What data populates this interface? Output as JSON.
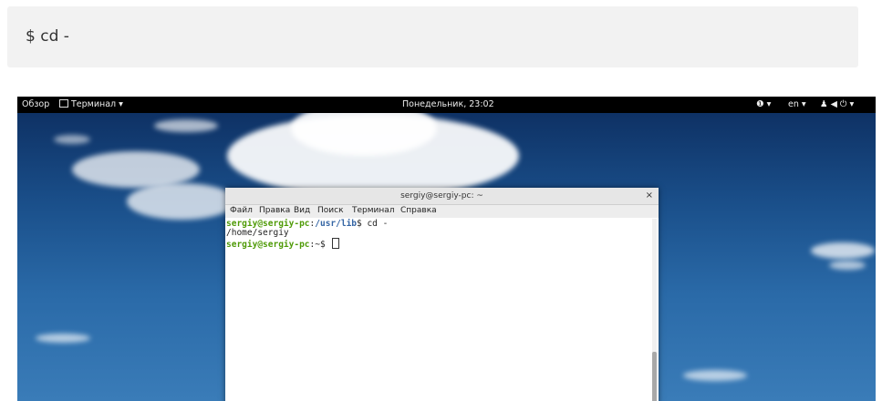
{
  "snippet": {
    "command": "$  cd -"
  },
  "topbar": {
    "overview": "Обзор",
    "app_menu": "Терминал ▾",
    "clock": "Понедельник, 23:02",
    "accessibility": "▾",
    "language": "en ▾",
    "status_icons": "⏻ ▾"
  },
  "terminal": {
    "title": "sergiy@sergiy-pc: ~",
    "close": "×",
    "menu": [
      "Файл",
      "Правка",
      "Вид",
      "Поиск",
      "Терминал",
      "Справка"
    ],
    "lines": {
      "l1_user": "sergiy@sergiy-pc",
      "l1_colon": ":",
      "l1_path": "/usr/lib",
      "l1_cmd": "$ cd -",
      "l2": "/home/sergiy",
      "l3_user": "sergiy@sergiy-pc",
      "l3_rest": ":~$ "
    }
  },
  "colors": {
    "prompt_user": "#4e9a06",
    "prompt_path": "#3465a4",
    "topbar": "#000000"
  }
}
